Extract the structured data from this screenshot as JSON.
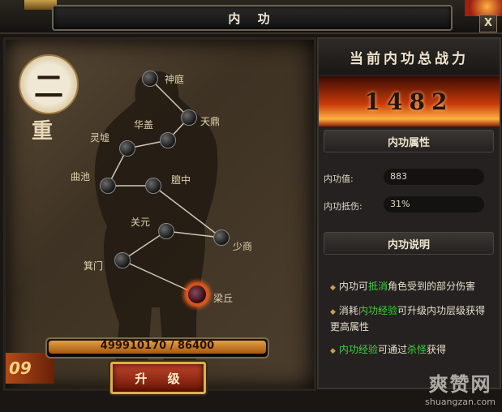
{
  "window": {
    "title": "内 功",
    "close_label": "X"
  },
  "level": {
    "big": "二",
    "sub": "重"
  },
  "meridian_points": [
    {
      "name": "神庭"
    },
    {
      "name": "天鼎"
    },
    {
      "name": "华盖"
    },
    {
      "name": "灵墟"
    },
    {
      "name": "曲池"
    },
    {
      "name": "膻中"
    },
    {
      "name": "关元"
    },
    {
      "name": "少商"
    },
    {
      "name": "箕门"
    },
    {
      "name": "梁丘",
      "active": true
    }
  ],
  "side_number": "09",
  "exp": {
    "text": "499910170 / 86400",
    "fill_fraction": 1.0
  },
  "upgrade_label": "升 级",
  "power": {
    "title": "当前内功总战力",
    "value": "1482"
  },
  "attributes": {
    "title": "内功属性",
    "rows": [
      {
        "label": "内功值:",
        "value": "883"
      },
      {
        "label": "内功抵伤:",
        "value": "31%"
      }
    ]
  },
  "description": {
    "title": "内功说明",
    "items": [
      {
        "parts": [
          {
            "t": "内功可"
          },
          {
            "t": "抵消",
            "hl": true
          },
          {
            "t": "角色受到的部分伤害"
          }
        ]
      },
      {
        "parts": [
          {
            "t": "消耗"
          },
          {
            "t": "内功经验",
            "hl": true
          },
          {
            "t": "可升级内功层级获得更高属性"
          }
        ]
      },
      {
        "parts": [
          {
            "t": "内功经验",
            "hl": true
          },
          {
            "t": "可通过"
          },
          {
            "t": "杀怪",
            "hl": true
          },
          {
            "t": "获得"
          }
        ]
      }
    ]
  },
  "watermark": {
    "big": "爽赞网",
    "small": "shuangzan.com"
  },
  "colors": {
    "highlight": "#40d040",
    "active_node": "#ff6a20",
    "exp_fill": "#e0a040"
  }
}
